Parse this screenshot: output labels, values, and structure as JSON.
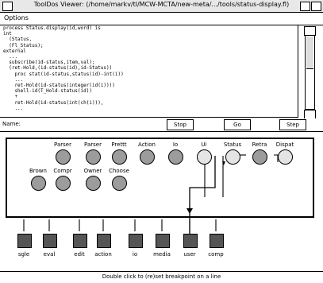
{
  "window": {
    "title": "ToolDos Viewer: (/home/markv/tl/MCW-MCTA/new-meta/.../tools/status-display.fl)",
    "buttons": {
      "left": "",
      "min": "",
      "max": ""
    }
  },
  "menu": {
    "options_label": "Options"
  },
  "code": {
    "lines": [
      "process Status.display(id,word) is",
      "int",
      "  (Status,",
      "  (Fl_Status);",
      "external",
      "  ...",
      "  subscribe(id-status,item,val);",
      "  (ret-Hold,(id-status(id),id-Status))",
      "    proc stat(id-status,status(id)-int(i))",
      "    ...",
      "    ret-Hold(id-status(integer(id(i))))",
      "    shell-id(T_Hold-status(id))",
      "    +",
      "    ret-Hold(id-status(int(ch(i))),",
      "    ..."
    ]
  },
  "controls": {
    "name_label": "Name:",
    "stop_left": "Stop",
    "go": "Go",
    "step": "Step"
  },
  "processes": [
    {
      "label": "Parser",
      "state": "dark"
    },
    {
      "label": "Parser",
      "state": "dark"
    },
    {
      "label": "Prettt",
      "state": "dark"
    },
    {
      "label": "Action",
      "state": "dark"
    },
    {
      "label": "Io",
      "state": "dark"
    },
    {
      "label": "Ui",
      "state": "light"
    },
    {
      "label": "Status",
      "state": "light"
    },
    {
      "label": "Retra",
      "state": "dark"
    },
    {
      "label": "Dispat",
      "state": "light"
    },
    {
      "label": "Brown",
      "state": "dark"
    },
    {
      "label": "Compr",
      "state": "dark"
    },
    {
      "label": "Owner",
      "state": "dark"
    },
    {
      "label": "Choose",
      "state": "dark"
    }
  ],
  "channels": [
    {
      "label": "sgle"
    },
    {
      "label": "eval"
    },
    {
      "label": "edit"
    },
    {
      "label": "action"
    },
    {
      "label": "io"
    },
    {
      "label": "media"
    },
    {
      "label": "user"
    },
    {
      "label": "comp"
    }
  ],
  "status": {
    "message": "Double click to (re)set breakpoint on a line"
  }
}
